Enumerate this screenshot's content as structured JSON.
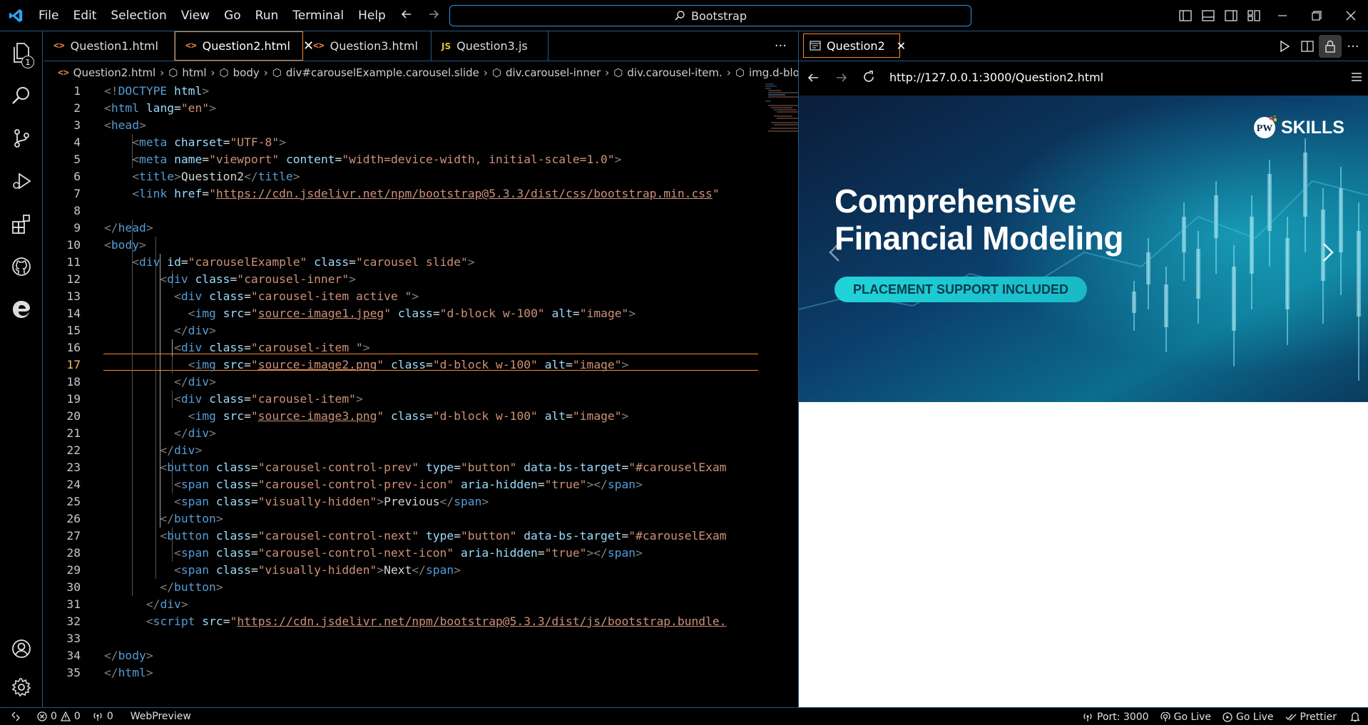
{
  "menu": [
    "File",
    "Edit",
    "Selection",
    "View",
    "Go",
    "Run",
    "Terminal",
    "Help"
  ],
  "command_center": "Bootstrap",
  "activity_badge": "1",
  "tabs": [
    {
      "label": "Question1.html",
      "icon": "<>",
      "state": "modified"
    },
    {
      "label": "Question2.html",
      "icon": "<>",
      "state": "active"
    },
    {
      "label": "Question3.html",
      "icon": "<>",
      "state": "normal"
    },
    {
      "label": "Question3.js",
      "icon": "JS",
      "state": "normal"
    }
  ],
  "tab_more": "···",
  "breadcrumb": [
    "Question2.html",
    "html",
    "body",
    "div#carouselExample.carousel.slide",
    "div.carousel-inner",
    "div.carousel-item.",
    "img.d-blo"
  ],
  "editor": {
    "current_line": 17,
    "lines": [
      "1",
      "2",
      "3",
      "4",
      "5",
      "6",
      "7",
      "8",
      "9",
      "10",
      "11",
      "12",
      "13",
      "14",
      "15",
      "16",
      "17",
      "18",
      "19",
      "20",
      "21",
      "22",
      "23",
      "24",
      "25",
      "26",
      "27",
      "28",
      "29",
      "30",
      "31",
      "32",
      "33",
      "34",
      "35"
    ]
  },
  "preview": {
    "tab_label": "Question2",
    "url": "http://127.0.0.1:3000/Question2.html",
    "slide": {
      "headline_line1": "Comprehensive",
      "headline_line2": "Financial Modeling",
      "pill": "PLACEMENT SUPPORT INCLUDED",
      "brand": "SKILLS",
      "brand_mark": "PW"
    }
  },
  "status": {
    "errors": "0",
    "warnings": "0",
    "ports": "0",
    "webpreview": "WebPreview",
    "port": "Port: 3000",
    "golive1": "Go Live",
    "golive2": "Go Live",
    "prettier": "Prettier"
  },
  "colors": {
    "accent": "#f38b2c",
    "border": "#1e5a8a",
    "tag": "#569cd6",
    "attr": "#9cdcfe",
    "string": "#ce9178"
  }
}
